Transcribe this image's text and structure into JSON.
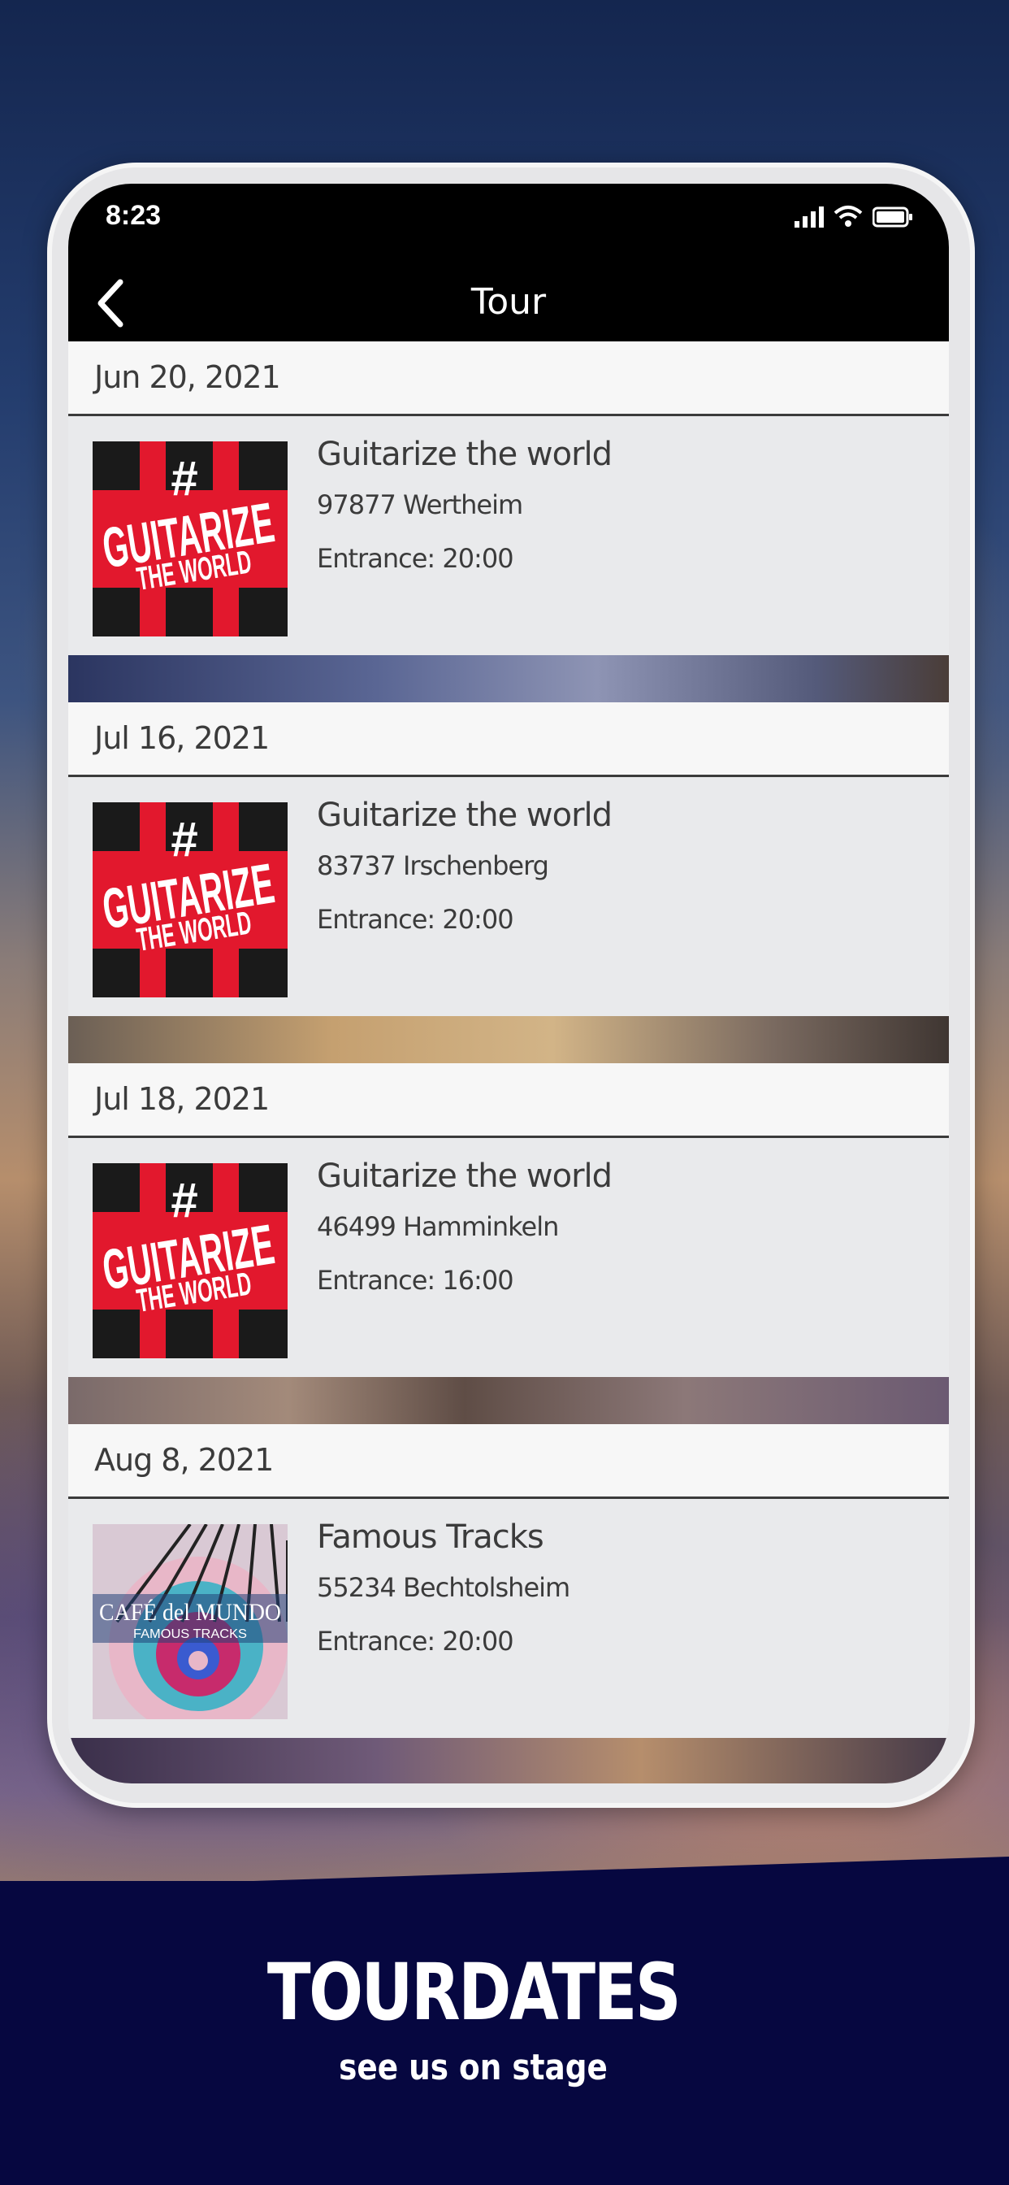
{
  "status_bar": {
    "time": "8:23"
  },
  "nav": {
    "title": "Tour"
  },
  "events": [
    {
      "date": "Jun 20, 2021",
      "title": "Guitarize the world",
      "city": "97877 Wertheim",
      "entrance": "Entrance: 20:00",
      "cover": "guitarize-cover"
    },
    {
      "date": "Jul 16, 2021",
      "title": "Guitarize the world",
      "city": "83737 Irschenberg",
      "entrance": "Entrance: 20:00",
      "cover": "guitarize-cover"
    },
    {
      "date": "Jul 18, 2021",
      "title": "Guitarize the world",
      "city": "46499 Hamminkeln",
      "entrance": "Entrance: 16:00",
      "cover": "guitarize-cover"
    },
    {
      "date": "Aug 8, 2021",
      "title": "Famous Tracks",
      "city": "55234 Bechtolsheim",
      "entrance": "Entrance: 20:00",
      "cover": "cafe-del-mundo-cover"
    }
  ],
  "covers": {
    "guitarize": {
      "line1": "#",
      "line2": "GUITARIZE",
      "line3": "THE WORLD"
    },
    "cafe": {
      "line1": "CAFÉ del MUNDO",
      "line2": "FAMOUS TRACKS"
    }
  },
  "banner": {
    "title": "TOURDATES",
    "subtitle": "see us on stage"
  },
  "colors": {
    "nav_bg": "#000000",
    "banner_bg": "#060740",
    "text": "#3b3b3b",
    "guitarize_red": "#e2182d"
  }
}
